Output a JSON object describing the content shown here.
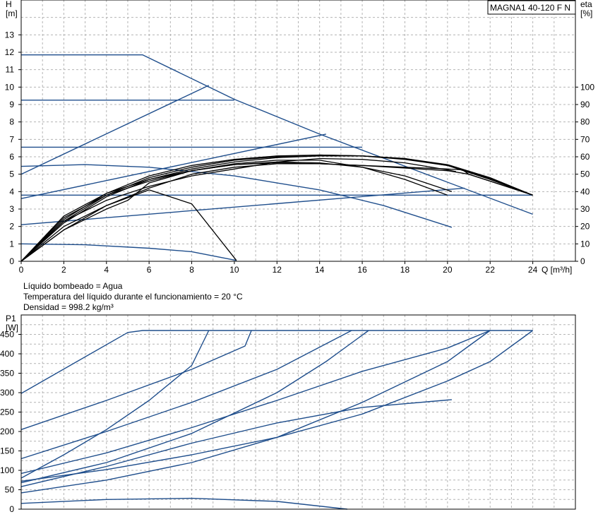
{
  "model_label": "MAGNA1 40-120 F N",
  "notes": {
    "liquid": "Líquido bombeado = Agua",
    "temperature": "Temperatura del líquido durante el funcionamiento = 20 °C",
    "density": "Densidad = 998.2 kg/m³"
  },
  "colors": {
    "blue": "#1f4e8c",
    "black": "#000000",
    "grid": "#b4b4b4"
  },
  "chart_data": [
    {
      "type": "line",
      "title": "MAGNA1 40-120 F N",
      "xlabel": "Q [m³/h]",
      "ylabel": "H\n[m]",
      "y2label": "eta\n[%]",
      "xlim": [
        0,
        26
      ],
      "ylim": [
        0,
        15
      ],
      "y2lim": [
        0,
        150
      ],
      "xticks": [
        0,
        2,
        4,
        6,
        8,
        10,
        12,
        14,
        16,
        18,
        20,
        22,
        24
      ],
      "yticks": [
        0,
        1,
        2,
        3,
        4,
        5,
        6,
        7,
        8,
        9,
        10,
        11,
        12,
        13
      ],
      "y2ticks": [
        0,
        10,
        20,
        30,
        40,
        50,
        60,
        70,
        80,
        90,
        100
      ],
      "grid": true,
      "series": [
        {
          "color": "blue",
          "axis": "y",
          "points": [
            [
              0,
              11.85
            ],
            [
              5.7,
              11.85
            ],
            [
              10,
              9.3
            ],
            [
              14,
              7.3
            ],
            [
              24,
              2.7
            ]
          ]
        },
        {
          "color": "blue",
          "axis": "y",
          "points": [
            [
              0,
              9.25
            ],
            [
              10,
              9.25
            ]
          ]
        },
        {
          "color": "blue",
          "axis": "y",
          "points": [
            [
              0,
              6.55
            ],
            [
              16,
              6.55
            ]
          ]
        },
        {
          "color": "blue",
          "axis": "y",
          "points": [
            [
              0,
              3.8
            ],
            [
              24,
              3.8
            ]
          ]
        },
        {
          "color": "blue",
          "axis": "y",
          "points": [
            [
              0,
              5.0
            ],
            [
              8.8,
              10.1
            ]
          ]
        },
        {
          "color": "blue",
          "axis": "y",
          "points": [
            [
              0,
              3.6
            ],
            [
              14.3,
              7.3
            ]
          ]
        },
        {
          "color": "blue",
          "axis": "y",
          "points": [
            [
              0,
              2.1
            ],
            [
              20.8,
              4.2
            ]
          ]
        },
        {
          "color": "blue",
          "axis": "y",
          "points": [
            [
              0,
              5.45
            ],
            [
              3,
              5.55
            ],
            [
              6,
              5.4
            ],
            [
              10,
              4.9
            ],
            [
              14,
              4.1
            ],
            [
              17,
              3.2
            ],
            [
              20.2,
              1.95
            ]
          ]
        },
        {
          "color": "blue",
          "axis": "y",
          "points": [
            [
              0,
              1.0
            ],
            [
              3,
              0.95
            ],
            [
              6,
              0.75
            ],
            [
              8,
              0.55
            ],
            [
              10.1,
              0.05
            ]
          ]
        },
        {
          "color": "black",
          "axis": "y",
          "points": [
            [
              0,
              0
            ],
            [
              2,
              1.8
            ],
            [
              4,
              3.2
            ],
            [
              6,
              4.1
            ],
            [
              8,
              3.3
            ],
            [
              10.1,
              0.05
            ]
          ]
        },
        {
          "color": "black",
          "axis": "y2",
          "points": [
            [
              0,
              0
            ],
            [
              2,
              23
            ],
            [
              4,
              35
            ],
            [
              6,
              43
            ],
            [
              8,
              49
            ],
            [
              10,
              53
            ],
            [
              12,
              57
            ],
            [
              14,
              59
            ],
            [
              16,
              58.5
            ],
            [
              18,
              56.5
            ],
            [
              20,
              52.5
            ],
            [
              20.4,
              51.5
            ]
          ]
        },
        {
          "color": "black",
          "axis": "y2",
          "points": [
            [
              0,
              0
            ],
            [
              2,
              25
            ],
            [
              4,
              38
            ],
            [
              6,
              46
            ],
            [
              8,
              52
            ],
            [
              10,
              56
            ],
            [
              12,
              58
            ],
            [
              14,
              58
            ],
            [
              16,
              54
            ],
            [
              18,
              47
            ],
            [
              20,
              38
            ]
          ]
        },
        {
          "color": "black",
          "axis": "y2",
          "points": [
            [
              0,
              0
            ],
            [
              2,
              26
            ],
            [
              4,
              39
            ],
            [
              6,
              47
            ],
            [
              8,
              52
            ],
            [
              10,
              55.5
            ],
            [
              12,
              57
            ],
            [
              14,
              56.5
            ],
            [
              16,
              54
            ],
            [
              18,
              49
            ],
            [
              20.2,
              40
            ]
          ]
        },
        {
          "color": "black",
          "axis": "y2",
          "points": [
            [
              0,
              0
            ],
            [
              2,
              22
            ],
            [
              4,
              37
            ],
            [
              6,
              47
            ],
            [
              8,
              53
            ],
            [
              10,
              57
            ],
            [
              12,
              59.5
            ],
            [
              14,
              60.5
            ],
            [
              16,
              60.5
            ],
            [
              18,
              59
            ],
            [
              20,
              55
            ],
            [
              22,
              47
            ],
            [
              24,
              38
            ]
          ]
        },
        {
          "color": "black",
          "axis": "y2",
          "points": [
            [
              0,
              0
            ],
            [
              2,
              23
            ],
            [
              4,
              38
            ],
            [
              6,
              48
            ],
            [
              8,
              54
            ],
            [
              10,
              58
            ],
            [
              12,
              60
            ],
            [
              14,
              61
            ],
            [
              16,
              60.5
            ],
            [
              18,
              58.5
            ],
            [
              20,
              55
            ],
            [
              22,
              47.5
            ],
            [
              24,
              38
            ]
          ]
        },
        {
          "color": "black",
          "axis": "y2",
          "points": [
            [
              0,
              0
            ],
            [
              2,
              24
            ],
            [
              4,
              39
            ],
            [
              6,
              49
            ],
            [
              8,
              55
            ],
            [
              10,
              58.5
            ],
            [
              12,
              60.5
            ],
            [
              14,
              61
            ],
            [
              16,
              60.5
            ],
            [
              18,
              59
            ],
            [
              20,
              55.5
            ],
            [
              22,
              48
            ],
            [
              24,
              38
            ]
          ]
        },
        {
          "color": "black",
          "axis": "y2",
          "points": [
            [
              0,
              0
            ],
            [
              2,
              18
            ],
            [
              4,
              30
            ],
            [
              5,
              35
            ],
            [
              6,
              45
            ],
            [
              8,
              52
            ],
            [
              10,
              55.5
            ],
            [
              12,
              56.5
            ],
            [
              14,
              56
            ],
            [
              16,
              55
            ],
            [
              18,
              53.5
            ],
            [
              20,
              52
            ],
            [
              21,
              50
            ],
            [
              22,
              46
            ],
            [
              24,
              38
            ]
          ]
        },
        {
          "color": "black",
          "axis": "y2",
          "points": [
            [
              0,
              0
            ],
            [
              2,
              20
            ],
            [
              4,
              32
            ],
            [
              6,
              42
            ],
            [
              8,
              50
            ],
            [
              10,
              54
            ],
            [
              12,
              56
            ],
            [
              14,
              56
            ],
            [
              16,
              55
            ],
            [
              18,
              54
            ],
            [
              20,
              53
            ],
            [
              20.7,
              52.5
            ],
            [
              21,
              50
            ],
            [
              22,
              46
            ],
            [
              24,
              38
            ]
          ]
        }
      ]
    },
    {
      "type": "line",
      "ylabel": "P1\n[W]",
      "xlim": [
        0,
        26
      ],
      "ylim": [
        0,
        500
      ],
      "yticks": [
        0,
        50,
        100,
        150,
        200,
        250,
        300,
        350,
        400,
        450
      ],
      "grid": true,
      "series": [
        {
          "color": "blue",
          "points": [
            [
              0,
              298
            ],
            [
              5,
              455
            ],
            [
              5.7,
              460
            ],
            [
              24,
              460
            ]
          ]
        },
        {
          "color": "blue",
          "points": [
            [
              0,
              205
            ],
            [
              4,
              280
            ],
            [
              8,
              360
            ],
            [
              10.5,
              420
            ],
            [
              10.8,
              460
            ]
          ]
        },
        {
          "color": "blue",
          "points": [
            [
              0,
              130
            ],
            [
              4,
              200
            ],
            [
              8,
              275
            ],
            [
              12,
              360
            ],
            [
              15.5,
              460
            ]
          ]
        },
        {
          "color": "blue",
          "points": [
            [
              0,
              68
            ],
            [
              4,
              120
            ],
            [
              8,
              195
            ],
            [
              12,
              300
            ],
            [
              14.3,
              380
            ],
            [
              16.3,
              460
            ]
          ]
        },
        {
          "color": "blue",
          "points": [
            [
              0,
              80
            ],
            [
              2,
              140
            ],
            [
              4,
              205
            ],
            [
              6,
              280
            ],
            [
              8,
              370
            ],
            [
              8.8,
              460
            ]
          ]
        },
        {
          "color": "blue",
          "points": [
            [
              0,
              92
            ],
            [
              4,
              145
            ],
            [
              8,
              210
            ],
            [
              12,
              280
            ],
            [
              16,
              355
            ],
            [
              20,
              415
            ],
            [
              22,
              460
            ]
          ]
        },
        {
          "color": "blue",
          "points": [
            [
              0,
              42
            ],
            [
              4,
              75
            ],
            [
              8,
              120
            ],
            [
              12,
              185
            ],
            [
              16,
              275
            ],
            [
              20,
              380
            ],
            [
              21,
              420
            ],
            [
              22,
              460
            ]
          ]
        },
        {
          "color": "blue",
          "points": [
            [
              0,
              72
            ],
            [
              4,
              102
            ],
            [
              8,
              140
            ],
            [
              12,
              185
            ],
            [
              16,
              245
            ],
            [
              20,
              330
            ],
            [
              22,
              380
            ],
            [
              24,
              460
            ]
          ]
        },
        {
          "color": "blue",
          "points": [
            [
              0,
              58
            ],
            [
              4,
              110
            ],
            [
              8,
              170
            ],
            [
              12,
              222
            ],
            [
              16,
              262
            ],
            [
              20.2,
              282
            ]
          ]
        },
        {
          "color": "blue",
          "points": [
            [
              0,
              15
            ],
            [
              4,
              25
            ],
            [
              8,
              28
            ],
            [
              12,
              20
            ],
            [
              15.3,
              0
            ]
          ]
        }
      ]
    }
  ]
}
